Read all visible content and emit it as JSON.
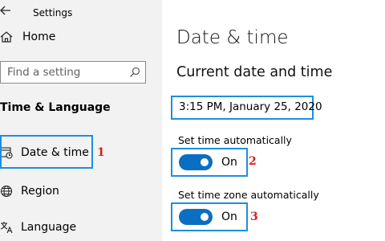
{
  "app": {
    "title": "Settings"
  },
  "sidebar": {
    "home_label": "Home",
    "search_placeholder": "Find a setting",
    "section_title": "Time & Language",
    "items": [
      {
        "label": "Date & time",
        "icon": "calendar-clock-icon",
        "selected": true
      },
      {
        "label": "Region",
        "icon": "globe-icon"
      },
      {
        "label": "Language",
        "icon": "language-icon"
      }
    ]
  },
  "main": {
    "page_title": "Date & time",
    "section_title": "Current date and time",
    "current_datetime": "3:15 PM, January 25, 2020",
    "settings": [
      {
        "label": "Set time automatically",
        "state": "On",
        "on": true
      },
      {
        "label": "Set time zone automatically",
        "state": "On",
        "on": true
      }
    ]
  },
  "annotations": {
    "marker_1": "1",
    "marker_2": "2",
    "marker_3": "3"
  },
  "colors": {
    "accent": "#0a6fc2",
    "highlight": "#1e8fdb",
    "marker": "#d81e1e",
    "sidebar_bg": "#f2f2f2"
  }
}
